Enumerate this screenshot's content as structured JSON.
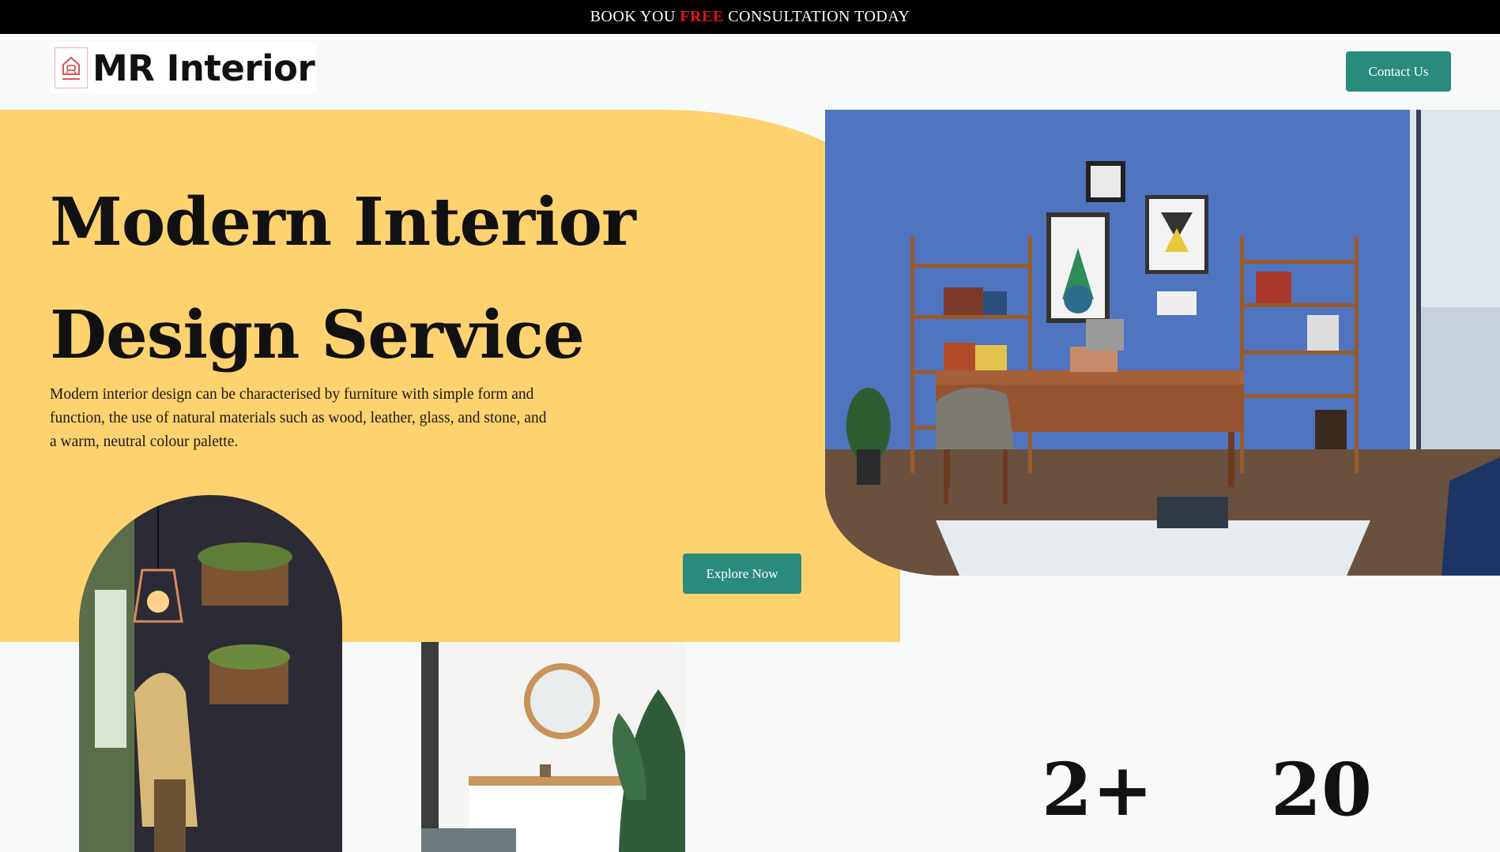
{
  "announcement": {
    "before": "BOOK YOU ",
    "highlight": "FREE",
    "after": " CONSULTATION TODAY"
  },
  "header": {
    "logo_text": "MR Interior",
    "logo_icon": "house-logo-icon",
    "contact_label": "Contact Us"
  },
  "hero": {
    "title_line1": "Modern Interior",
    "title_line2": "Design Service",
    "description": "Modern interior design can be characterised by furniture with simple form and function, the use of natural materials such as wood, leather, glass, and stone, and a warm, neutral colour palette.",
    "cta_label": "Explore Now"
  },
  "stats": [
    {
      "value": "2+"
    },
    {
      "value": "20"
    }
  ],
  "colors": {
    "accent": "#2a8b7d",
    "hero_bg": "#fed26e",
    "highlight": "#e3121d",
    "topbar": "#000000"
  }
}
